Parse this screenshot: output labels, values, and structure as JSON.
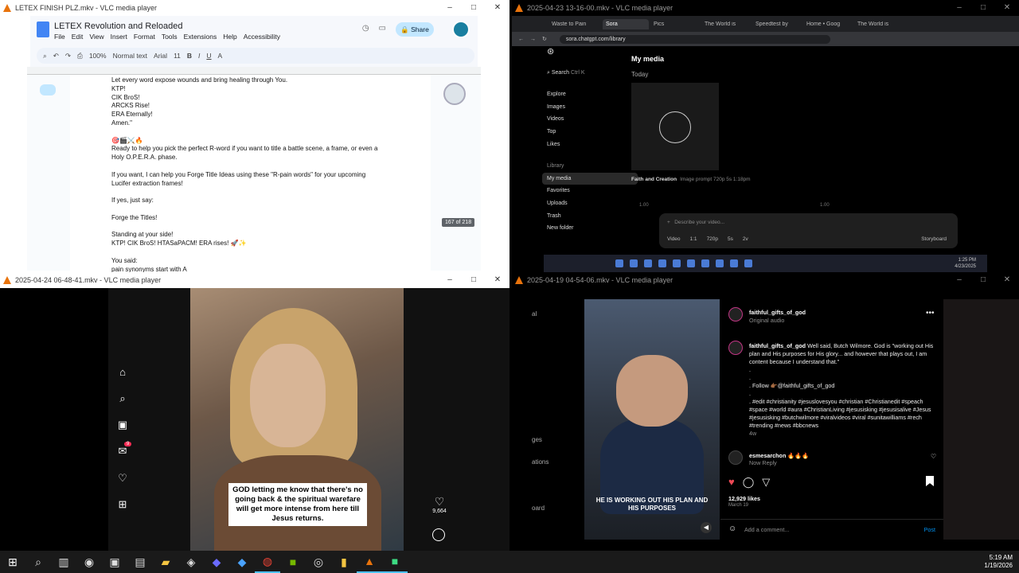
{
  "windows": {
    "top_left": {
      "title": "LETEX FINISH PLZ.mkv - VLC media player"
    },
    "top_right": {
      "title": "2025-04-23 13-16-00.mkv - VLC media player"
    },
    "bottom_left": {
      "title": "2025-04-24 06-48-41.mkv - VLC media player"
    },
    "bottom_right": {
      "title": "2025-04-19 04-54-06.mkv - VLC media player"
    }
  },
  "window_controls": [
    "–",
    "□",
    "✕"
  ],
  "docs": {
    "title": "LETEX Revolution and Reloaded",
    "menu": [
      "File",
      "Edit",
      "View",
      "Insert",
      "Format",
      "Tools",
      "Extensions",
      "Help",
      "Accessibility"
    ],
    "share_label": "Share",
    "zoom": "100%",
    "style": "Normal text",
    "font": "Arial",
    "font_size": "11",
    "page_indicator": "167 of 218",
    "lines": [
      "Let every word expose wounds and bring healing through You.",
      "KTP!",
      "CIK BroS!",
      "ARCKS Rise!",
      "ERA Eternally!",
      "Amen.\"",
      "",
      "🎯🎬⚔️🔥",
      "Ready to help you pick the perfect R-word if you want to title a battle scene, a frame, or even a",
      "Holy O.P.E.R.A. phase.",
      "",
      "If you want, I can help you Forge Title Ideas using these \"R-pain words\" for your upcoming",
      "Lucifer extraction frames!",
      "",
      "If yes, just say:",
      "",
      "Forge the Titles!",
      "",
      "Standing at your side!",
      "KTP! CIK BroS! HTASaPACM! ERA rises! 🚀✨",
      "",
      "You said:",
      "pain synonyms start with A"
    ]
  },
  "sora": {
    "tabs": [
      "Waste to Pain",
      "Sora",
      "Pics",
      "The World is",
      "Speedtest by",
      "Home • Goog",
      "The World is"
    ],
    "url": "sora.chatgpt.com/library",
    "search_label": "Search",
    "search_shortcut": "Ctrl K",
    "nav": [
      "Explore",
      "Images",
      "Videos",
      "Top",
      "Likes"
    ],
    "library_header": "Library",
    "library": [
      "My media",
      "Favorites",
      "Uploads",
      "Trash",
      "New folder"
    ],
    "title": "My media",
    "today": "Today",
    "caption": "Faith and Creation",
    "caption_meta": "Image prompt   720p   5s   1:18pm",
    "prompt_placeholder": "Describe your video...",
    "prompt_options": [
      "Video",
      "1:1",
      "720p",
      "5s",
      "2v"
    ],
    "storyboard": "Storyboard",
    "scale_left": "1.00",
    "scale_right": "1.00",
    "mini_time": "1:25 PM",
    "mini_date": "4/23/2025"
  },
  "tiktok": {
    "caption": "GOD letting me know that there's no going back & the spiritual warefare will get more intense from here till Jesus returns.",
    "likes": "9,664",
    "badge": "9"
  },
  "instagram": {
    "left_labels": [
      "al",
      "ges",
      "ations",
      "oard"
    ],
    "username": "faithful_gifts_of_god",
    "audio": "Original audio",
    "caption": "Well said, Butch Wilmore. God is \"working out His plan and His purposes for His glory... and however that plays out, I am content because I understand that.\"",
    "follow": ". Follow 👉🏾@faithful_gifts_of_god",
    "hashtags": ". #edit #christianity #jesuslovesyou #christian #Christianedit #speach #space #world #aura #ChristianLiving #jesusisking #jesusisalive #Jesus #jesusisking #butchwilmore #viralvideos #viral #sunitawilliams #rech #trending #news #bbcnews",
    "age": "4w",
    "commenter": "esmesarchon",
    "comment": "🔥🔥🔥",
    "comment_meta": "Now   Reply",
    "likes": "12,929 likes",
    "date": "March 19",
    "add_comment": "Add a comment...",
    "post_label": "Post",
    "video_caption": "HE IS WORKING OUT HIS PLAN AND HIS PURPOSES"
  },
  "taskbar": {
    "time": "5:19 AM",
    "date": "1/19/2026"
  }
}
